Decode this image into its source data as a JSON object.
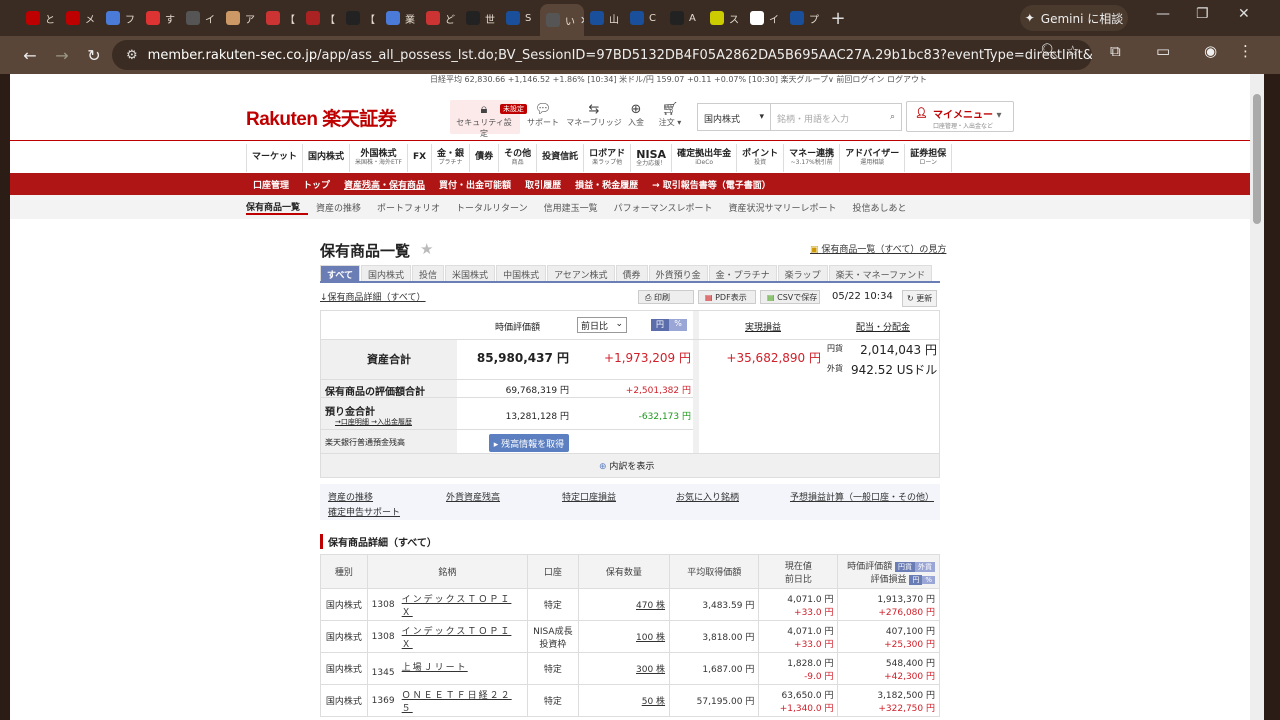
{
  "browser": {
    "tabs": [
      {
        "icon": "rakuten",
        "label": "と",
        "color": "#bf0000"
      },
      {
        "icon": "rakuten",
        "label": "メ",
        "color": "#bf0000"
      },
      {
        "icon": "docs",
        "label": "フ",
        "color": "#4a7bd8"
      },
      {
        "icon": "multi",
        "label": "す",
        "color": "#d33"
      },
      {
        "icon": "blank",
        "label": "イ",
        "color": "#555"
      },
      {
        "icon": "tcs",
        "label": "ア",
        "color": "#c96"
      },
      {
        "icon": "kabu",
        "label": "【",
        "color": "#c33"
      },
      {
        "icon": "3k",
        "label": "【",
        "color": "#a22"
      },
      {
        "icon": "x",
        "label": "【",
        "color": "#222"
      },
      {
        "icon": "docs",
        "label": "業",
        "color": "#4a7bd8"
      },
      {
        "icon": "red",
        "label": "ど",
        "color": "#c33"
      },
      {
        "icon": "chart",
        "label": "世",
        "color": "#222"
      },
      {
        "icon": "sbi",
        "label": "S",
        "color": "#1a4f9c"
      },
      {
        "icon": "active",
        "label": "い",
        "color": "#555"
      },
      {
        "icon": "m",
        "label": "山",
        "color": "#1a4f9c"
      },
      {
        "icon": "m",
        "label": "C",
        "color": "#1a4f9c"
      },
      {
        "icon": "inv",
        "label": "A",
        "color": "#222"
      },
      {
        "icon": "y",
        "label": "ス",
        "color": "#cc0"
      },
      {
        "icon": "g",
        "label": "イ",
        "color": "#fff"
      },
      {
        "icon": "m",
        "label": "プ",
        "color": "#1a4f9c"
      }
    ],
    "gemini_label": "Gemini に相談",
    "url_host": "member.rakuten-sec.co.jp",
    "url_path": "/app/ass_all_possess_lst.do;BV_SessionID=97BD5132DB4F05A2862DA5B695AAC27A.29b1bc83?eventType=directInit&l-id=mem_pc_top_..."
  },
  "header": {
    "ticker": "日経平均 62,830.66 +1,146.52 +1.86% [10:34]  米ドル/円 159.07 +0.11 +0.07% [10:30]  楽天グループ∨  前回ログイン  ログアウト",
    "logo": "Rakuten 楽天証券",
    "icons": [
      {
        "label": "セキュリティ設定",
        "badge": "未設定"
      },
      {
        "label": "サポート"
      },
      {
        "label": "マネーブリッジ"
      },
      {
        "label": "入金"
      },
      {
        "label": "注文 ▾"
      }
    ],
    "search_type": "国内株式",
    "search_placeholder": "銘柄・用語を入力",
    "mymenu": "マイメニュー",
    "mymenu_sub": "口座管理・入出金など"
  },
  "mainnav": [
    {
      "label": "マーケット",
      "sub": ""
    },
    {
      "label": "国内株式",
      "sub": ""
    },
    {
      "label": "外国株式",
      "sub": "米国株・海外ETF"
    },
    {
      "label": "FX",
      "sub": ""
    },
    {
      "label": "金・銀",
      "sub": "プラチナ"
    },
    {
      "label": "債券",
      "sub": ""
    },
    {
      "label": "その他",
      "sub": "商品"
    },
    {
      "label": "投資信託",
      "sub": ""
    },
    {
      "label": "ロボアド",
      "sub": "楽ラップ他"
    },
    {
      "label": "NISA",
      "sub": "全力応援！"
    },
    {
      "label": "確定拠出年金",
      "sub": "iDeCo"
    },
    {
      "label": "ポイント",
      "sub": "投資"
    },
    {
      "label": "マネー連携",
      "sub": "~3.17%税引前"
    },
    {
      "label": "アドバイザー",
      "sub": "運用相談"
    },
    {
      "label": "証券担保",
      "sub": "ローン"
    }
  ],
  "rednav": [
    "口座管理",
    "トップ",
    "資産残高・保有商品",
    "買付・出金可能額",
    "取引履歴",
    "損益・税金履歴",
    "→ 取引報告書等（電子書面）"
  ],
  "subnav": [
    "保有商品一覧",
    "資産の推移",
    "ポートフォリオ",
    "トータルリターン",
    "信用建玉一覧",
    "パフォーマンスレポート",
    "資産状況サマリーレポート",
    "投信あしあと"
  ],
  "page": {
    "title": "保有商品一覧",
    "howto": "保有商品一覧（すべて）の見方",
    "tabs": [
      "すべて",
      "国内株式",
      "投信",
      "米国株式",
      "中国株式",
      "アセアン株式",
      "債券",
      "外貨預り金",
      "金・プラチナ",
      "楽ラップ",
      "楽天・マネーファンド"
    ],
    "detail_link": "↓保有商品詳細（すべて）",
    "print": "印刷",
    "pdf": "PDF表示",
    "csv": "CSVで保存",
    "datetime": "05/22 10:34",
    "refresh": "更新"
  },
  "summary": {
    "col_value": "時価評価額",
    "col_select": "前日比",
    "toggle_yen": "円",
    "toggle_pct": "%",
    "col_realized": "実現損益",
    "col_dividend": "配当・分配金",
    "total_label": "資産合計",
    "total_value": "85,980,437 円",
    "total_change": "+1,973,209 円",
    "realized": "+35,682,890 円",
    "div_yen_label": "円貨",
    "div_yen": "2,014,043 円",
    "div_usd_label": "外貨",
    "div_usd": "942.52 USドル",
    "holdings_label": "保有商品の評価額合計",
    "holdings_value": "69,768,319 円",
    "holdings_change": "+2,501,382 円",
    "deposit_label": "預り金合計",
    "deposit_sub": "→口座明細 →入出金履歴",
    "deposit_value": "13,281,128 円",
    "deposit_change": "-632,173 円",
    "bank_label": "楽天銀行普通預金残高",
    "bank_button": "▸ 残高情報を取得",
    "breakdown": "内訳を表示"
  },
  "links": [
    "資産の推移",
    "外貨資産残高",
    "特定口座損益",
    "お気に入り銘柄",
    "予想損益計算（一般口座・その他）",
    "確定申告サポート"
  ],
  "detail": {
    "title": "保有商品詳細（すべて）",
    "headers": [
      "種別",
      "銘柄",
      "口座",
      "保有数量",
      "平均取得価額",
      "現在値",
      "前日比",
      "時価評価額",
      "評価損益"
    ],
    "rows": [
      {
        "type": "国内株式",
        "code": "1308",
        "name": "インデックスＴＯＰＩＸ",
        "account": "特定",
        "qty": "470 株",
        "avg": "3,483.59 円",
        "price": "4,071.0 円",
        "chg": "+33.0 円",
        "value": "1,913,370 円",
        "pl": "+276,080 円"
      },
      {
        "type": "国内株式",
        "code": "1308",
        "name": "インデックスＴＯＰＩＸ",
        "account": "NISA成長投資枠",
        "qty": "100 株",
        "avg": "3,818.00 円",
        "price": "4,071.0 円",
        "chg": "+33.0 円",
        "value": "407,100 円",
        "pl": "+25,300 円"
      },
      {
        "type": "国内株式",
        "code": "1345",
        "name": "上場Ｊリート",
        "account": "特定",
        "qty": "300 株",
        "avg": "1,687.00 円",
        "price": "1,828.0 円",
        "chg": "-9.0 円",
        "value": "548,400 円",
        "pl": "+42,300 円"
      },
      {
        "type": "国内株式",
        "code": "1369",
        "name": "ＯＮＥＥＴＦ日経２２５",
        "account": "特定",
        "qty": "50 株",
        "avg": "57,195.00 円",
        "price": "63,650.0 円",
        "chg": "+1,340.0 円",
        "value": "3,182,500 円",
        "pl": "+322,750 円"
      }
    ]
  }
}
